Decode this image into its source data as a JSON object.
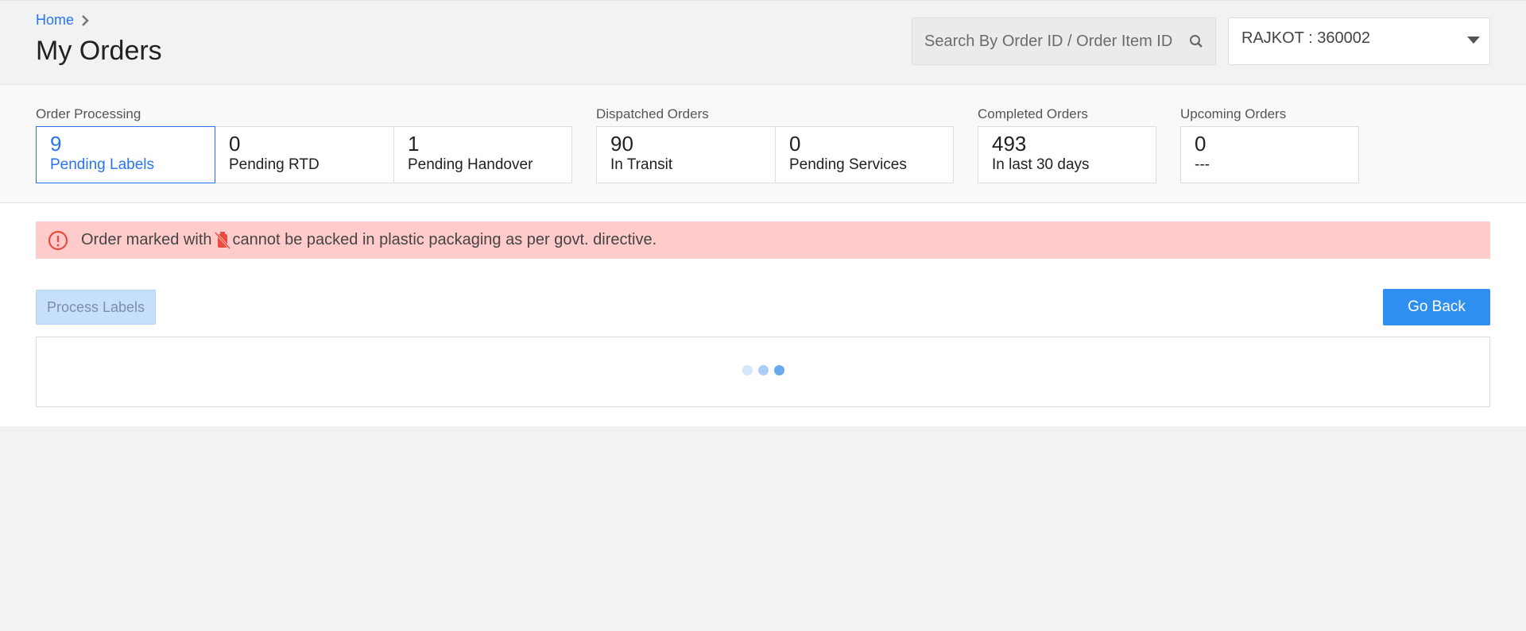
{
  "header": {
    "breadcrumb_home": "Home",
    "title": "My Orders",
    "search_placeholder": "Search By Order ID / Order Item ID",
    "location": "RAJKOT : 360002"
  },
  "stats": {
    "order_processing": {
      "label": "Order Processing",
      "cards": [
        {
          "value": "9",
          "label": "Pending Labels"
        },
        {
          "value": "0",
          "label": "Pending RTD"
        },
        {
          "value": "1",
          "label": "Pending Handover"
        }
      ]
    },
    "dispatched": {
      "label": "Dispatched Orders",
      "cards": [
        {
          "value": "90",
          "label": "In Transit"
        },
        {
          "value": "0",
          "label": "Pending Services"
        }
      ]
    },
    "completed": {
      "label": "Completed Orders",
      "cards": [
        {
          "value": "493",
          "label": "In last 30 days"
        }
      ]
    },
    "upcoming": {
      "label": "Upcoming Orders",
      "cards": [
        {
          "value": "0",
          "label": "---"
        }
      ]
    }
  },
  "alert": {
    "text_before": "Order marked with",
    "text_after": "cannot be packed in plastic packaging as per govt. directive.",
    "icon": "no-plastic-icon"
  },
  "actions": {
    "process_labels": "Process Labels",
    "go_back": "Go Back"
  },
  "colors": {
    "accent": "#2874f0",
    "button_primary": "#2e8ff0",
    "alert_bg": "#ffcccb",
    "alert_icon": "#e74c3c"
  }
}
